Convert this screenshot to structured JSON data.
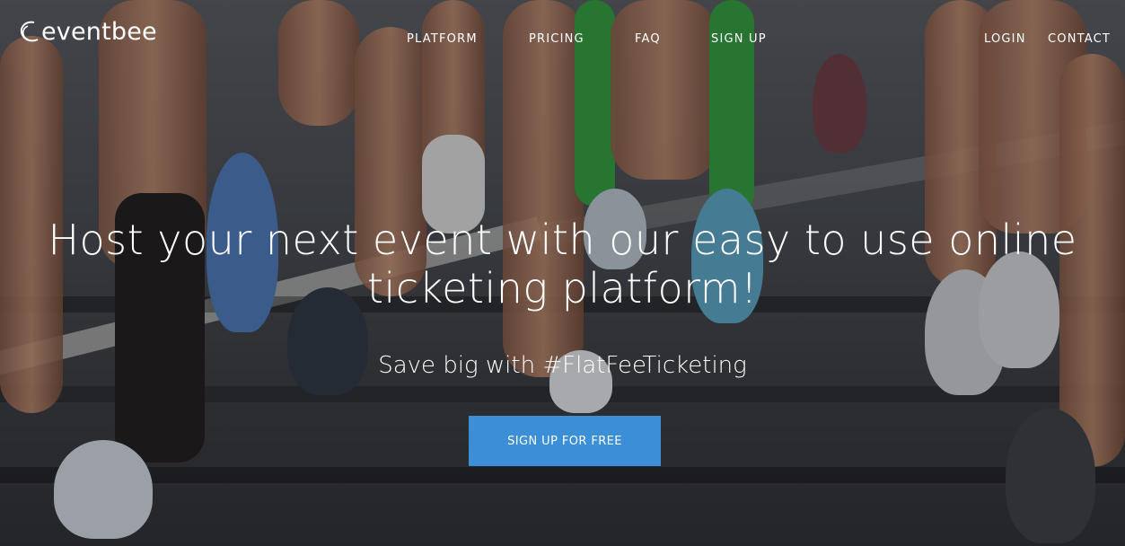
{
  "brand": {
    "name": "eventbee",
    "icon": "eventbee-logo-icon"
  },
  "nav": {
    "left_links": [
      "PLATFORM",
      "PRICING",
      "FAQ",
      "SIGN UP"
    ],
    "right_links": [
      "LOGIN",
      "CONTACT"
    ]
  },
  "hero": {
    "headline_line1": "Host your next event with our easy to use online",
    "headline_line2": "ticketing platform!",
    "subheadline": "Save big with #FlatFeeTicketing",
    "cta_label": "SIGN UP FOR FREE"
  },
  "colors": {
    "cta_background": "#3b8fd6",
    "text": "#ffffff"
  }
}
